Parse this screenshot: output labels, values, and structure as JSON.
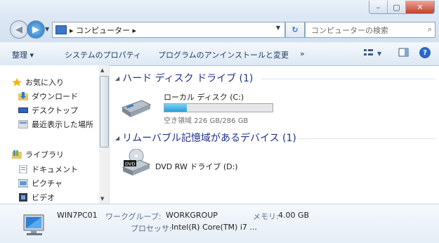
{
  "window": {
    "minimize_glyph": "–",
    "maximize_glyph": "▢",
    "close_glyph": "✕"
  },
  "address_bar": {
    "path": "▸ コンピューター ▸",
    "search_placeholder": "コンピューターの検索"
  },
  "command_bar": {
    "organize": "整理 ▾",
    "system_properties": "システムのプロパティ",
    "uninstall_programs": "プログラムのアンインストールと変更",
    "more": "»"
  },
  "nav_pane": {
    "favorites": "お気に入り",
    "downloads": "ダウンロード",
    "desktop": "デスクトップ",
    "recent_places": "最近表示した場所",
    "libraries": "ライブラリ",
    "documents": "ドキュメント",
    "pictures": "ピクチャ",
    "videos": "ビデオ"
  },
  "content": {
    "hdd_group": "ハード ディスク ドライブ (1)",
    "local_disk_name": "ローカル ディスク (C:)",
    "local_disk_free": "空き領域 226 GB/286 GB",
    "local_disk_used_fraction": 0.21,
    "removable_group": "リムーバブル記憶域があるデバイス (1)",
    "dvd_name": "DVD RW ドライブ (D:)",
    "dvd_badge": "DVD"
  },
  "details": {
    "computer_name": "WIN7PC01",
    "workgroup_label": "ワークグループ:",
    "workgroup_value": "WORKGROUP",
    "memory_label": "メモリ:",
    "memory_value": "4.00 GB",
    "processor_label": "プロセッサ:",
    "processor_value": "Intel(R) Core(TM) i7 ..."
  },
  "colors": {
    "accent": "#26a0da",
    "link": "#1e3287"
  }
}
